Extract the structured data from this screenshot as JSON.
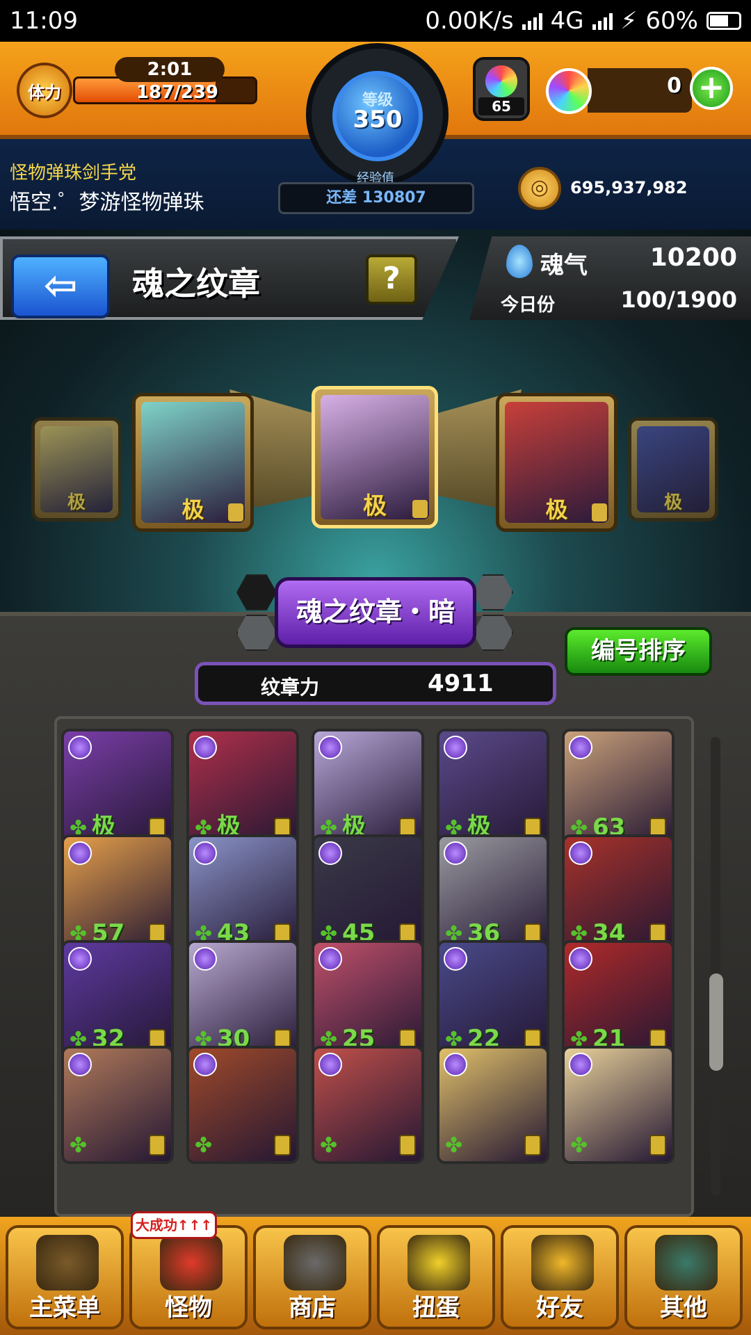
{
  "status_bar": {
    "time": "11:09",
    "net_speed": "0.00K/s",
    "network": "4G",
    "battery": "60%"
  },
  "header": {
    "stamina_label": "体力",
    "stamina_timer": "2:01",
    "stamina_value": "187/239",
    "stamina_fraction": 0.78,
    "rank_label": "等级",
    "rank_value": "350",
    "exp_label": "经验值",
    "exp_remaining": "还差 130807",
    "orb_stock": "65",
    "orb_count": "0",
    "user_title": "怪物弹珠剑手党",
    "user_name": "悟空.゜梦游怪物弹珠",
    "gold": "695,937,982"
  },
  "page": {
    "title": "魂之纹章",
    "help": "?"
  },
  "soul": {
    "label": "魂气",
    "value": "10200",
    "today_label": "今日份",
    "today_value": "100/1900"
  },
  "carousel": [
    {
      "rank": "极",
      "color": "#d8c36a"
    },
    {
      "rank": "极",
      "color": "#7fd3c8"
    },
    {
      "rank": "极",
      "color": "#d7b0e6"
    },
    {
      "rank": "极",
      "color": "#c8403a"
    },
    {
      "rank": "极",
      "color": "#4a4fa0"
    }
  ],
  "section": {
    "title": "魂之纹章・暗",
    "sort_button": "编号排序",
    "power_label": "纹章力",
    "power_value": "4911"
  },
  "monsters": [
    {
      "lvl": "极",
      "color": "#7a3ea8"
    },
    {
      "lvl": "极",
      "color": "#b0304a"
    },
    {
      "lvl": "极",
      "color": "#b7a7d8"
    },
    {
      "lvl": "极",
      "color": "#5a4a8a"
    },
    {
      "lvl": "63",
      "color": "#c9a07a"
    },
    {
      "lvl": "57",
      "color": "#e6a04a"
    },
    {
      "lvl": "43",
      "color": "#8a94c8"
    },
    {
      "lvl": "45",
      "color": "#3a3a48"
    },
    {
      "lvl": "36",
      "color": "#9a9aa0"
    },
    {
      "lvl": "34",
      "color": "#a8322a"
    },
    {
      "lvl": "32",
      "color": "#5e3aa0"
    },
    {
      "lvl": "30",
      "color": "#b8a8d0"
    },
    {
      "lvl": "25",
      "color": "#c0506a"
    },
    {
      "lvl": "22",
      "color": "#4a4a8a"
    },
    {
      "lvl": "21",
      "color": "#b02a2a"
    },
    {
      "lvl": "",
      "color": "#b07a5a"
    },
    {
      "lvl": "",
      "color": "#a04a2a"
    },
    {
      "lvl": "",
      "color": "#c0504a"
    },
    {
      "lvl": "",
      "color": "#e0c06a"
    },
    {
      "lvl": "",
      "color": "#e8d09a"
    }
  ],
  "nav": [
    {
      "label": "主菜单",
      "icon": "gate-icon",
      "color": "#7a5a2a"
    },
    {
      "label": "怪物",
      "icon": "monster-icon",
      "color": "#e03a2a"
    },
    {
      "label": "商店",
      "icon": "orb-icon",
      "color": "#6a6a6a"
    },
    {
      "label": "扭蛋",
      "icon": "egg-icon",
      "color": "#f0d02a"
    },
    {
      "label": "好友",
      "icon": "friends-icon",
      "color": "#f0b82a"
    },
    {
      "label": "其他",
      "icon": "question-icon",
      "color": "#3a7a6a"
    }
  ],
  "nav_badge": "大成功↑↑↑"
}
